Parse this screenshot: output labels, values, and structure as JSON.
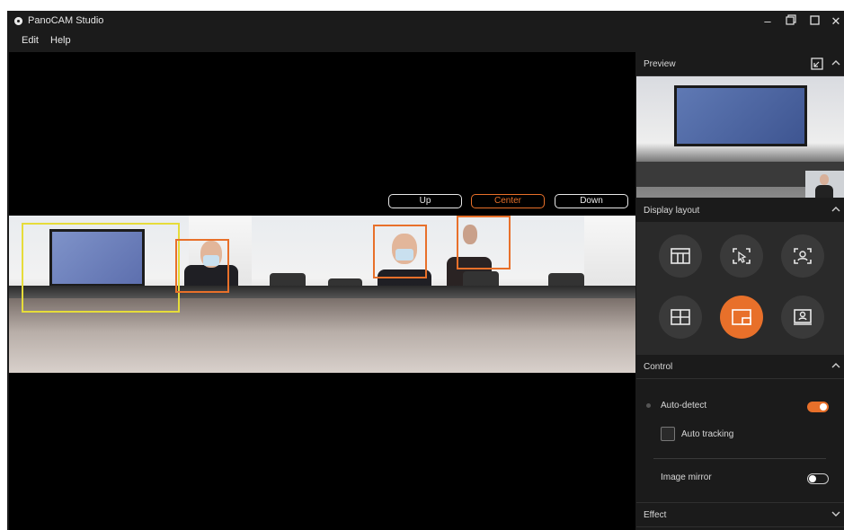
{
  "app": {
    "title": "PanoCAM Studio"
  },
  "menu": {
    "items": [
      "Edit",
      "Help"
    ]
  },
  "view_controls": {
    "up": "Up",
    "center": "Center",
    "down": "Down",
    "active": "Center"
  },
  "side": {
    "preview_title": "Preview",
    "layout_title": "Display layout",
    "layout_buttons": [
      "panorama-layout-icon",
      "pointer-focus-icon",
      "person-focus-icon",
      "quad-grid-icon",
      "picture-in-picture-icon",
      "presenter-icon"
    ],
    "active_layout": "picture-in-picture-icon",
    "control_title": "Control",
    "auto_detect": {
      "label": "Auto-detect",
      "on": true
    },
    "auto_tracking": {
      "label": "Auto tracking",
      "checked": false
    },
    "image_mirror": {
      "label": "Image mirror",
      "on": false
    },
    "effect_title": "Effect"
  },
  "colors": {
    "accent": "#e8702a",
    "detect_yellow": "#e6dc3a",
    "background": "#1b1b1b"
  }
}
